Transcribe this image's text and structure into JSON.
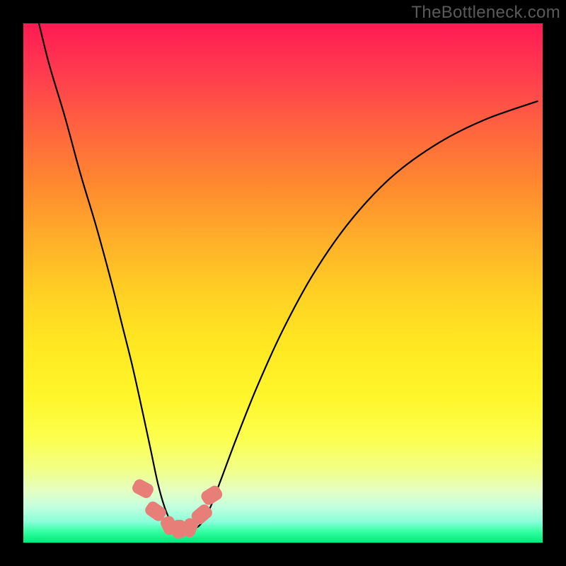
{
  "watermark": "TheBottleneck.com",
  "chart_data": {
    "type": "line",
    "title": "",
    "xlabel": "",
    "ylabel": "",
    "xlim": [
      0,
      100
    ],
    "ylim": [
      0,
      100
    ],
    "grid": false,
    "series": [
      {
        "name": "bottleneck-curve",
        "x": [
          3,
          5,
          8,
          11,
          14,
          17,
          19,
          21,
          23,
          24.5,
          26,
          27.5,
          29,
          30.5,
          32,
          34,
          36,
          38,
          41,
          45,
          50,
          56,
          63,
          71,
          80,
          89,
          99
        ],
        "values": [
          100,
          92,
          82,
          71,
          61,
          50,
          42,
          34,
          25,
          18,
          11,
          6,
          3.2,
          2.4,
          2.4,
          3.4,
          6.8,
          12,
          20,
          30,
          41,
          52,
          62,
          70.5,
          77,
          81.5,
          85
        ]
      }
    ],
    "markers": [
      {
        "name": "marker-left-upper",
        "x": 23.0,
        "y": 10.4,
        "w": 2.8,
        "h": 4.0,
        "rot": -62
      },
      {
        "name": "marker-left-lower",
        "x": 25.5,
        "y": 6.0,
        "w": 2.8,
        "h": 4.0,
        "rot": -55
      },
      {
        "name": "marker-bottom-1",
        "x": 28.0,
        "y": 3.3,
        "w": 2.7,
        "h": 3.6,
        "rot": -25
      },
      {
        "name": "marker-bottom-2",
        "x": 30.0,
        "y": 2.6,
        "w": 2.7,
        "h": 3.6,
        "rot": 0
      },
      {
        "name": "marker-bottom-3",
        "x": 32.0,
        "y": 2.9,
        "w": 2.7,
        "h": 3.6,
        "rot": 22
      },
      {
        "name": "marker-right-lower",
        "x": 34.3,
        "y": 5.4,
        "w": 2.8,
        "h": 4.0,
        "rot": 50
      },
      {
        "name": "marker-right-upper",
        "x": 36.3,
        "y": 9.1,
        "w": 2.8,
        "h": 4.0,
        "rot": 58
      }
    ]
  }
}
